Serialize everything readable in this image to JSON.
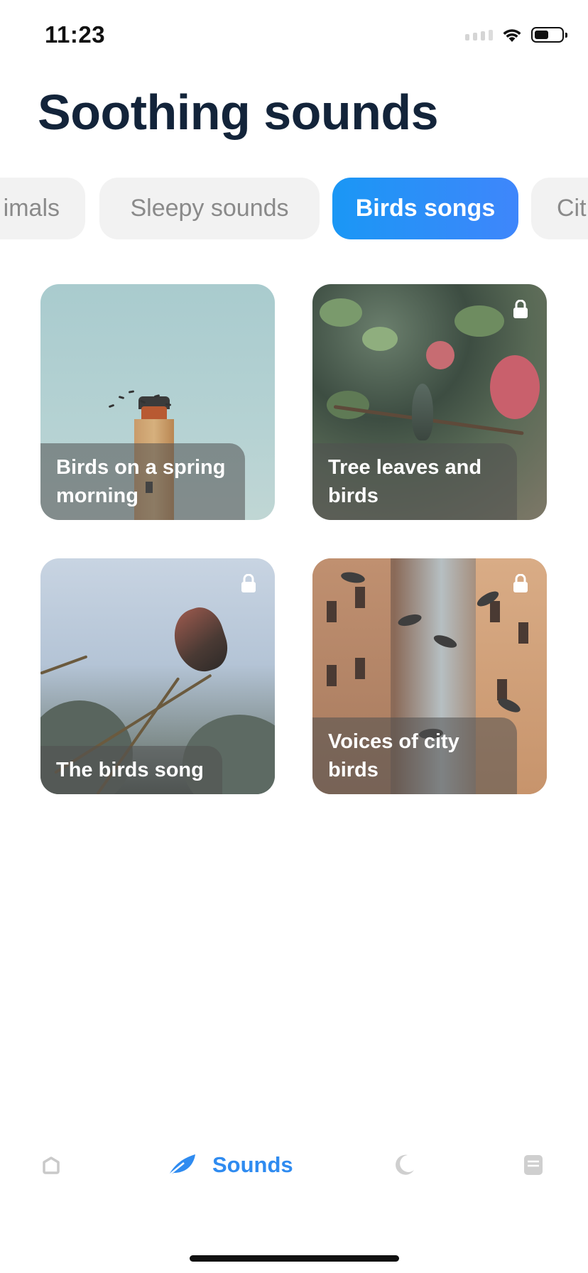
{
  "status_bar": {
    "time": "11:23",
    "battery_level": 0.55
  },
  "page": {
    "title": "Soothing sounds"
  },
  "categories": [
    {
      "label": "imals",
      "active": false
    },
    {
      "label": "Sleepy sounds",
      "active": false
    },
    {
      "label": "Birds songs",
      "active": true
    },
    {
      "label": "Cit",
      "active": false
    }
  ],
  "cards": [
    {
      "title": "Birds on a spring morning",
      "locked": false
    },
    {
      "title": "Tree leaves and birds",
      "locked": true
    },
    {
      "title": "The birds song",
      "locked": true
    },
    {
      "title": "Voices of city birds",
      "locked": true
    }
  ],
  "nav": {
    "active": "Sounds",
    "items": [
      {
        "icon": "home-icon"
      },
      {
        "icon": "feather-icon",
        "label": "Sounds"
      },
      {
        "icon": "moon-icon"
      },
      {
        "icon": "journal-icon"
      }
    ]
  },
  "colors": {
    "accent": "#2f8bf0",
    "title": "#13243a",
    "inactive_tab": "#f2f2f2"
  }
}
